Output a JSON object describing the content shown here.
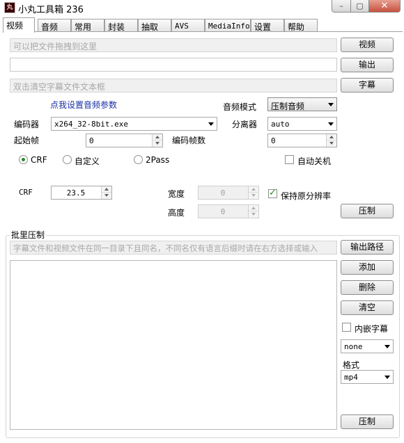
{
  "window": {
    "title": "小丸工具箱 236",
    "icon_text": "丸",
    "controls": {
      "minimize": "–",
      "maximize": "▢",
      "close": "✕"
    }
  },
  "tabs": [
    {
      "label": "视频",
      "active": true
    },
    {
      "label": "音频",
      "active": false
    },
    {
      "label": "常用",
      "active": false
    },
    {
      "label": "封装",
      "active": false
    },
    {
      "label": "抽取",
      "active": false
    },
    {
      "label": "AVS",
      "active": false
    },
    {
      "label": "MediaInfo",
      "active": false
    },
    {
      "label": "设置",
      "active": false
    },
    {
      "label": "帮助",
      "active": false
    }
  ],
  "video": {
    "input_placeholder": "可以把文件拖拽到这里",
    "output_value": "",
    "subtitle_placeholder": "双击清空字幕文件文本框",
    "btn_video": "视频",
    "btn_output": "输出",
    "btn_subtitle": "字幕",
    "audio_params_link": "点我设置音频参数",
    "audio_mode_label": "音频模式",
    "audio_mode_value": "压制音频",
    "encoder_label": "编码器",
    "encoder_value": "x264_32-8bit.exe",
    "splitter_label": "分离器",
    "splitter_value": "auto",
    "start_frame_label": "起始帧",
    "start_frame_value": "0",
    "frame_count_label": "编码帧数",
    "frame_count_value": "0",
    "mode_crf": "CRF",
    "mode_custom": "自定义",
    "mode_2pass": "2Pass",
    "auto_shutdown": "自动关机",
    "crf_label": "CRF",
    "crf_value": "23.5",
    "width_label": "宽度",
    "width_value": "0",
    "height_label": "高度",
    "height_value": "0",
    "keep_resolution": "保持原分辨率",
    "btn_encode": "压制"
  },
  "batch": {
    "title": "批里压制",
    "hint_placeholder": "字幕文件和视频文件在同一目录下且同名，不同名仅有语言后缀时请在右方选择或输入",
    "btn_output_path": "输出路径",
    "btn_add": "添加",
    "btn_delete": "删除",
    "btn_clear": "清空",
    "embed_subtitle": "内嵌字幕",
    "subtitle_lang_value": "none",
    "format_label": "格式",
    "format_value": "mp4",
    "btn_encode": "压制"
  },
  "colors": {
    "link": "#1a2fa0",
    "check_green": "#2a8a2a",
    "close_button": "#c75040"
  }
}
